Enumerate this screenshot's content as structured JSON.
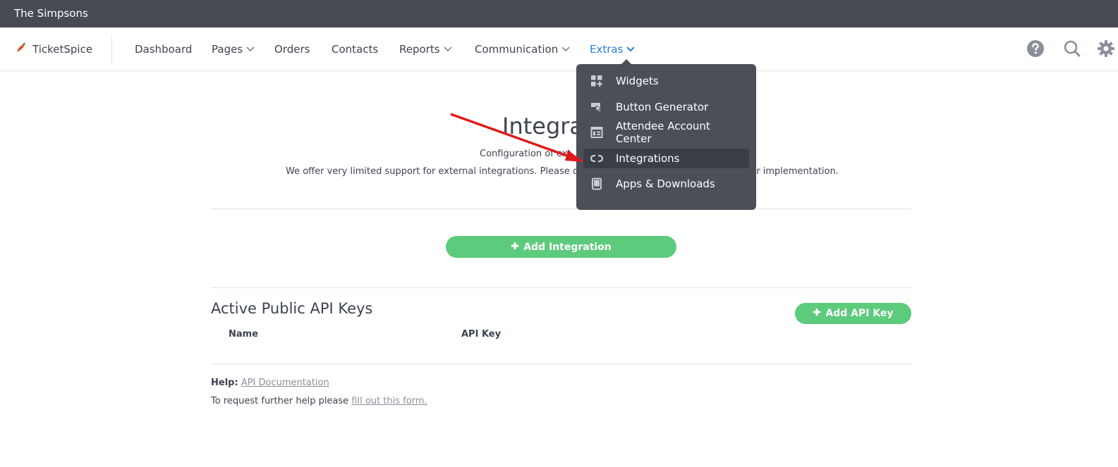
{
  "topbar": {
    "account_name": "The Simpsons"
  },
  "brand": {
    "name": "TicketSpice",
    "logo_icon": "chili-pepper-icon"
  },
  "nav": {
    "items": [
      {
        "label": "Dashboard",
        "has_caret": false
      },
      {
        "label": "Pages",
        "has_caret": true
      },
      {
        "label": "Orders",
        "has_caret": false
      },
      {
        "label": "Contacts",
        "has_caret": false
      },
      {
        "label": "Reports",
        "has_caret": true
      },
      {
        "label": "Communication",
        "has_caret": true
      },
      {
        "label": "Extras",
        "has_caret": true,
        "active": true
      }
    ],
    "right_icons": [
      "help-icon",
      "search-icon",
      "gear-icon"
    ]
  },
  "dropdown": {
    "items": [
      {
        "label": "Widgets",
        "icon": "widgets-icon"
      },
      {
        "label": "Button Generator",
        "icon": "cursor-button-icon"
      },
      {
        "label": "Attendee Account Center",
        "icon": "account-center-icon"
      },
      {
        "label": "Integrations",
        "icon": "link-icon",
        "selected": true
      },
      {
        "label": "Apps & Downloads",
        "icon": "tablet-icon"
      }
    ]
  },
  "main": {
    "title": "Integrat",
    "subtitle_line1": "Configuration of ext",
    "subtitle_line2_left": "We offer very limited support for external integrations. Please consul",
    "subtitle_line2_right": "ur implementation.",
    "add_integration_label": "Add Integration"
  },
  "api_keys": {
    "title": "Active Public API Keys",
    "add_label": "Add API Key",
    "columns": [
      "Name",
      "API Key"
    ]
  },
  "help": {
    "label": "Help:",
    "doc_link": "API Documentation",
    "request_text": "To request further help please",
    "form_link": "fill out this form."
  },
  "colors": {
    "accent": "#2a7fd4",
    "green": "#5ccb7c",
    "dropdown_bg": "#4b4f57",
    "topbar_bg": "#464a53",
    "annotation_arrow": "#e0191b"
  }
}
